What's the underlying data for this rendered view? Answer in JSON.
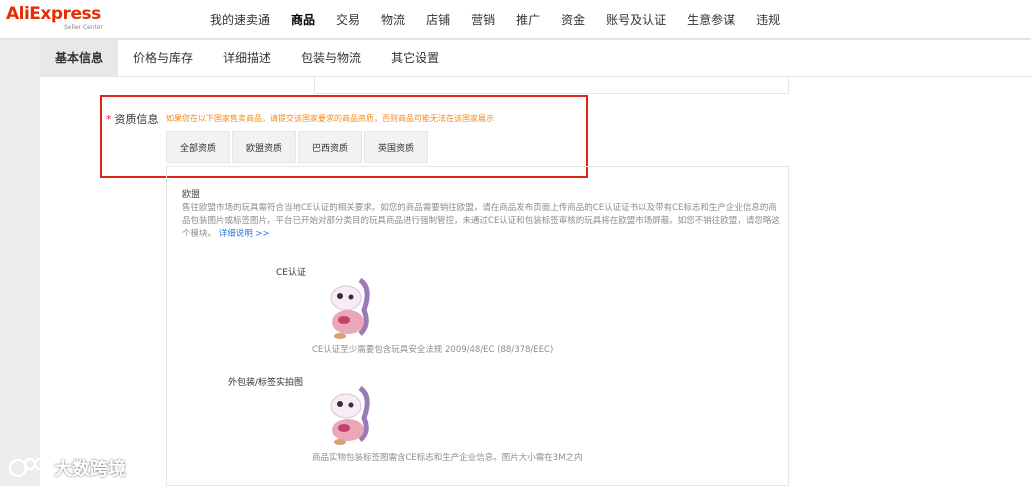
{
  "header": {
    "brand": "AliExpress",
    "brand_sub": "Seller Center",
    "nav": [
      "我的速卖通",
      "商品",
      "交易",
      "物流",
      "店铺",
      "营销",
      "推广",
      "资金",
      "账号及认证",
      "生意参谋",
      "违规"
    ],
    "active_nav": "商品"
  },
  "tabs": [
    "基本信息",
    "价格与库存",
    "详细描述",
    "包装与物流",
    "其它设置"
  ],
  "active_tab": "基本信息",
  "qualification": {
    "required_mark": "*",
    "label": "资质信息",
    "hint": "如果您在以下国家售卖商品，请提交该国家要求的商品资质，否则商品可能无法在该国家展示",
    "region_tabs": [
      "全部资质",
      "欧盟资质",
      "巴西资质",
      "英国资质"
    ]
  },
  "eu_section": {
    "title": "欧盟",
    "description": "售往欧盟市场的玩具需符合当地CE认证的相关要求。如您的商品需要销往欧盟，请在商品发布页面上传商品的CE认证证书以及带有CE标志和生产企业信息的商品包装图片或标签图片。平台已开始对部分类目的玩具商品进行强制管控，未通过CE认证和包装标签审核的玩具将在欧盟市场屏蔽。如您不销往欧盟，请忽略这个模块。",
    "detail_link": "详细说明 >>",
    "ce_label": "CE认证",
    "ce_caption": "CE认证至少需要包含玩具安全法规 2009/48/EC (88/378/EEC)",
    "package_label": "外包装/标签实拍图",
    "package_caption": "商品实物包装标签图需含CE标志和生产企业信息。图片大小需在3M之内"
  },
  "watermark": "大数跨境",
  "colors": {
    "brand": "#e62e04",
    "highlight_box": "#e1251b",
    "hint": "#f08a1a",
    "link": "#2e7bd6"
  }
}
